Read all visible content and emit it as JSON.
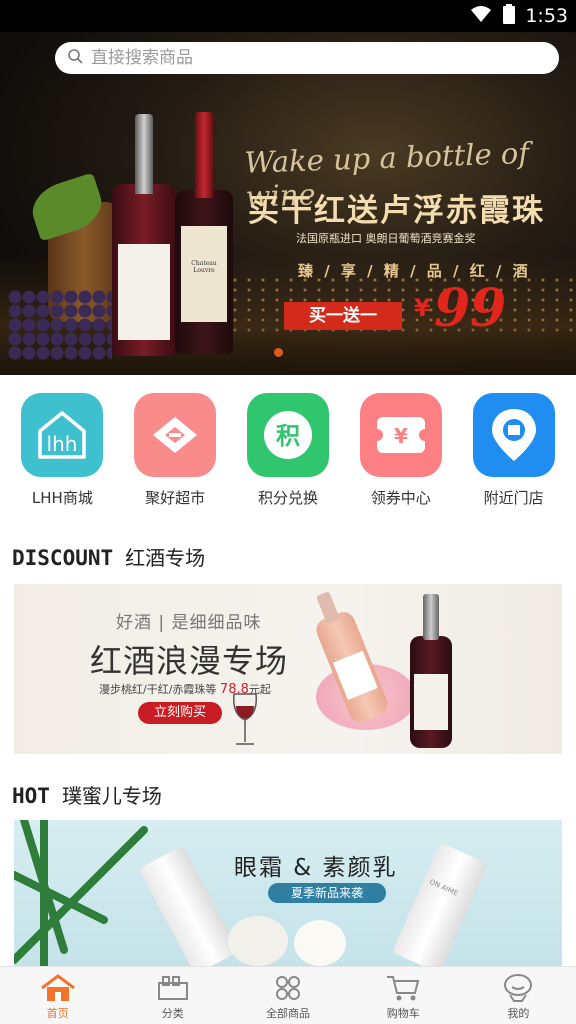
{
  "status_bar": {
    "time": "1:53"
  },
  "search": {
    "placeholder": "直接搜索商品"
  },
  "banner": {
    "script": "Wake up a bottle of wine",
    "title": "买干红送卢浮赤霞珠",
    "subtitle": "法国原瓶进口   奥朗日葡萄酒竞赛金奖",
    "tagline": "臻 / 享 / 精 / 品 / 红 / 酒",
    "buy_label": "买一送一",
    "price_symbol": "¥",
    "price": "99",
    "bottle_label_1": "Chateau Louvre"
  },
  "categories": [
    {
      "label": "LHH商城",
      "icon": "lhh-house-icon",
      "color": "#3fc0cf",
      "glyph": "lhh"
    },
    {
      "label": "聚好超市",
      "icon": "supermarket-icon",
      "color": "#f98b8b",
      "glyph": ""
    },
    {
      "label": "积分兑换",
      "icon": "points-icon",
      "color": "#2fc66d",
      "glyph": "积"
    },
    {
      "label": "领券中心",
      "icon": "coupon-icon",
      "color": "#fb7f83",
      "glyph": "¥"
    },
    {
      "label": "附近门店",
      "icon": "location-icon",
      "color": "#1f8ef0",
      "glyph": ""
    }
  ],
  "discount": {
    "en": "DISCOUNT",
    "cn": "红酒专场",
    "promo_small": "好酒 | 是细细品味",
    "promo_big": "红酒浪漫专场",
    "promo_line_prefix": "漫步桃红/干红/赤霞珠等",
    "promo_price": "78.8",
    "promo_line_suffix": "元起",
    "promo_button": "立刻购买"
  },
  "hot": {
    "en": "HOT",
    "cn": "璞蜜儿专场",
    "promo_title": "眼霜 & 素颜乳",
    "promo_sub": "夏季新品来袭",
    "brand": "ON AIME"
  },
  "tabbar": [
    {
      "label": "首页",
      "icon": "home-icon",
      "active": true
    },
    {
      "label": "分类",
      "icon": "category-icon",
      "active": false
    },
    {
      "label": "全部商品",
      "icon": "all-products-icon",
      "active": false
    },
    {
      "label": "购物车",
      "icon": "cart-icon",
      "active": false
    },
    {
      "label": "我的",
      "icon": "profile-icon",
      "active": false
    }
  ],
  "colors": {
    "accent": "#f2732a",
    "banner_red": "#e1261c"
  }
}
